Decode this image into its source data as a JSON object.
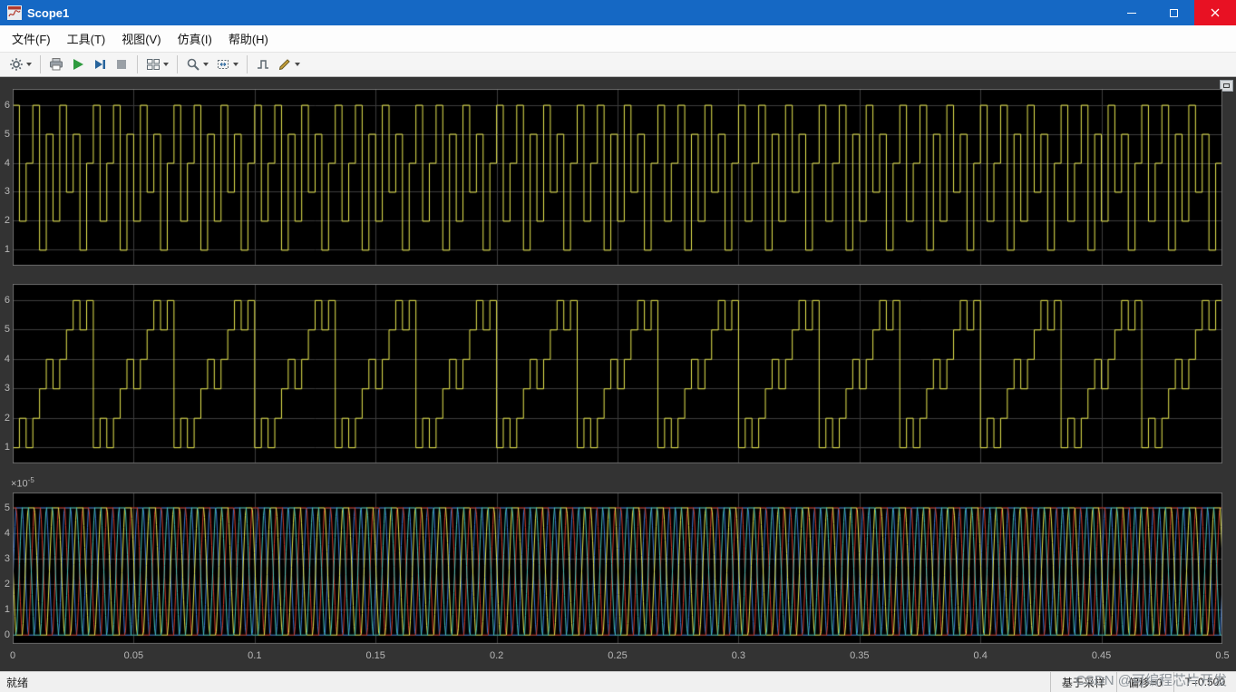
{
  "window": {
    "title": "Scope1"
  },
  "titlebar": {
    "buttons": [
      "minimize",
      "maximize",
      "close"
    ]
  },
  "menus": [
    {
      "label": "文件(F)"
    },
    {
      "label": "工具(T)"
    },
    {
      "label": "视图(V)"
    },
    {
      "label": "仿真(I)"
    },
    {
      "label": "帮助(H)"
    }
  ],
  "toolbar": {
    "buttons": [
      {
        "name": "configuration-properties",
        "icon": "gear-icon",
        "has_dropdown": true
      },
      {
        "name": "print",
        "icon": "printer-icon",
        "has_dropdown": false
      },
      {
        "name": "run",
        "icon": "play-icon",
        "color": "#2e9b3e"
      },
      {
        "name": "step-forward",
        "icon": "step-forward-icon",
        "color": "#27649c"
      },
      {
        "name": "stop",
        "icon": "stop-icon",
        "color": "#9aa0a6"
      },
      {
        "name": "layout",
        "icon": "layout-icon",
        "has_dropdown": true
      },
      {
        "name": "zoom",
        "icon": "magnifier-icon",
        "has_dropdown": true
      },
      {
        "name": "fit-to-view",
        "icon": "fit-view-icon",
        "has_dropdown": true
      },
      {
        "name": "trigger",
        "icon": "trigger-icon",
        "has_dropdown": false
      },
      {
        "name": "measurements",
        "icon": "pencil-icon",
        "has_dropdown": true
      }
    ]
  },
  "statusbar": {
    "left": "就绪",
    "segments": [
      "基于采样",
      "偏移=0",
      "T=0.500"
    ]
  },
  "watermark": {
    "text": "CSDN @可编程芯片开发"
  },
  "chart_data": {
    "type": "line",
    "title": "",
    "x_range": [
      0,
      0.5
    ],
    "x_ticks": [
      0,
      0.05,
      0.1,
      0.15,
      0.2,
      0.25,
      0.3,
      0.35,
      0.4,
      0.45,
      0.5
    ],
    "x_tick_labels": [
      "0",
      "0.05",
      "0.1",
      "0.15",
      "0.2",
      "0.25",
      "0.3",
      "0.35",
      "0.4",
      "0.45",
      "0.5"
    ],
    "plot_bg": "#000000",
    "figure_bg": "#333333",
    "grid_color": "#3d3d3d",
    "border_color": "#6e6e6e",
    "tick_label_color": "#b8b8b8",
    "panes": [
      {
        "name": "signal-1-step-sequence",
        "type": "step",
        "color": "#e9e94f",
        "y_ticks": [
          1,
          2,
          3,
          4,
          5,
          6
        ],
        "y_tick_labels": [
          "1",
          "2",
          "3",
          "4",
          "5",
          "6"
        ],
        "y_range": [
          0.45,
          6.55
        ],
        "period": 0.033333,
        "levels": [
          6,
          2,
          4,
          6,
          1,
          5,
          2,
          6,
          3,
          5,
          1,
          4
        ]
      },
      {
        "name": "signal-2-staircase",
        "type": "step",
        "color": "#e9e94f",
        "y_ticks": [
          1,
          2,
          3,
          4,
          5,
          6
        ],
        "y_tick_labels": [
          "1",
          "2",
          "3",
          "4",
          "5",
          "6"
        ],
        "y_range": [
          0.45,
          6.55
        ],
        "period": 0.033333,
        "levels": [
          1,
          2,
          1,
          2,
          3,
          4,
          3,
          4,
          5,
          6,
          5,
          6
        ]
      },
      {
        "name": "signal-3-phase-waveforms",
        "type": "clipped_sine",
        "y_ticks": [
          0,
          1,
          2,
          3,
          4,
          5
        ],
        "y_tick_labels": [
          "0",
          "1",
          "2",
          "3",
          "4",
          "5"
        ],
        "y_range": [
          -0.35,
          5.6
        ],
        "exponent_label": "×10^-5",
        "exp_prefix": "×10",
        "exp_sup": "-5",
        "frequency_hz": 100,
        "amplitude": 5,
        "drive": 0.78,
        "series": [
          {
            "name": "phase-1",
            "color": "#3c7dd9",
            "phase_deg": 0
          },
          {
            "name": "phase-2",
            "color": "#d13b2a",
            "phase_deg": 90
          },
          {
            "name": "phase-3",
            "color": "#e9e94f",
            "phase_deg": 180
          },
          {
            "name": "phase-4",
            "color": "#45c3b8",
            "phase_deg": 270
          }
        ]
      }
    ]
  }
}
